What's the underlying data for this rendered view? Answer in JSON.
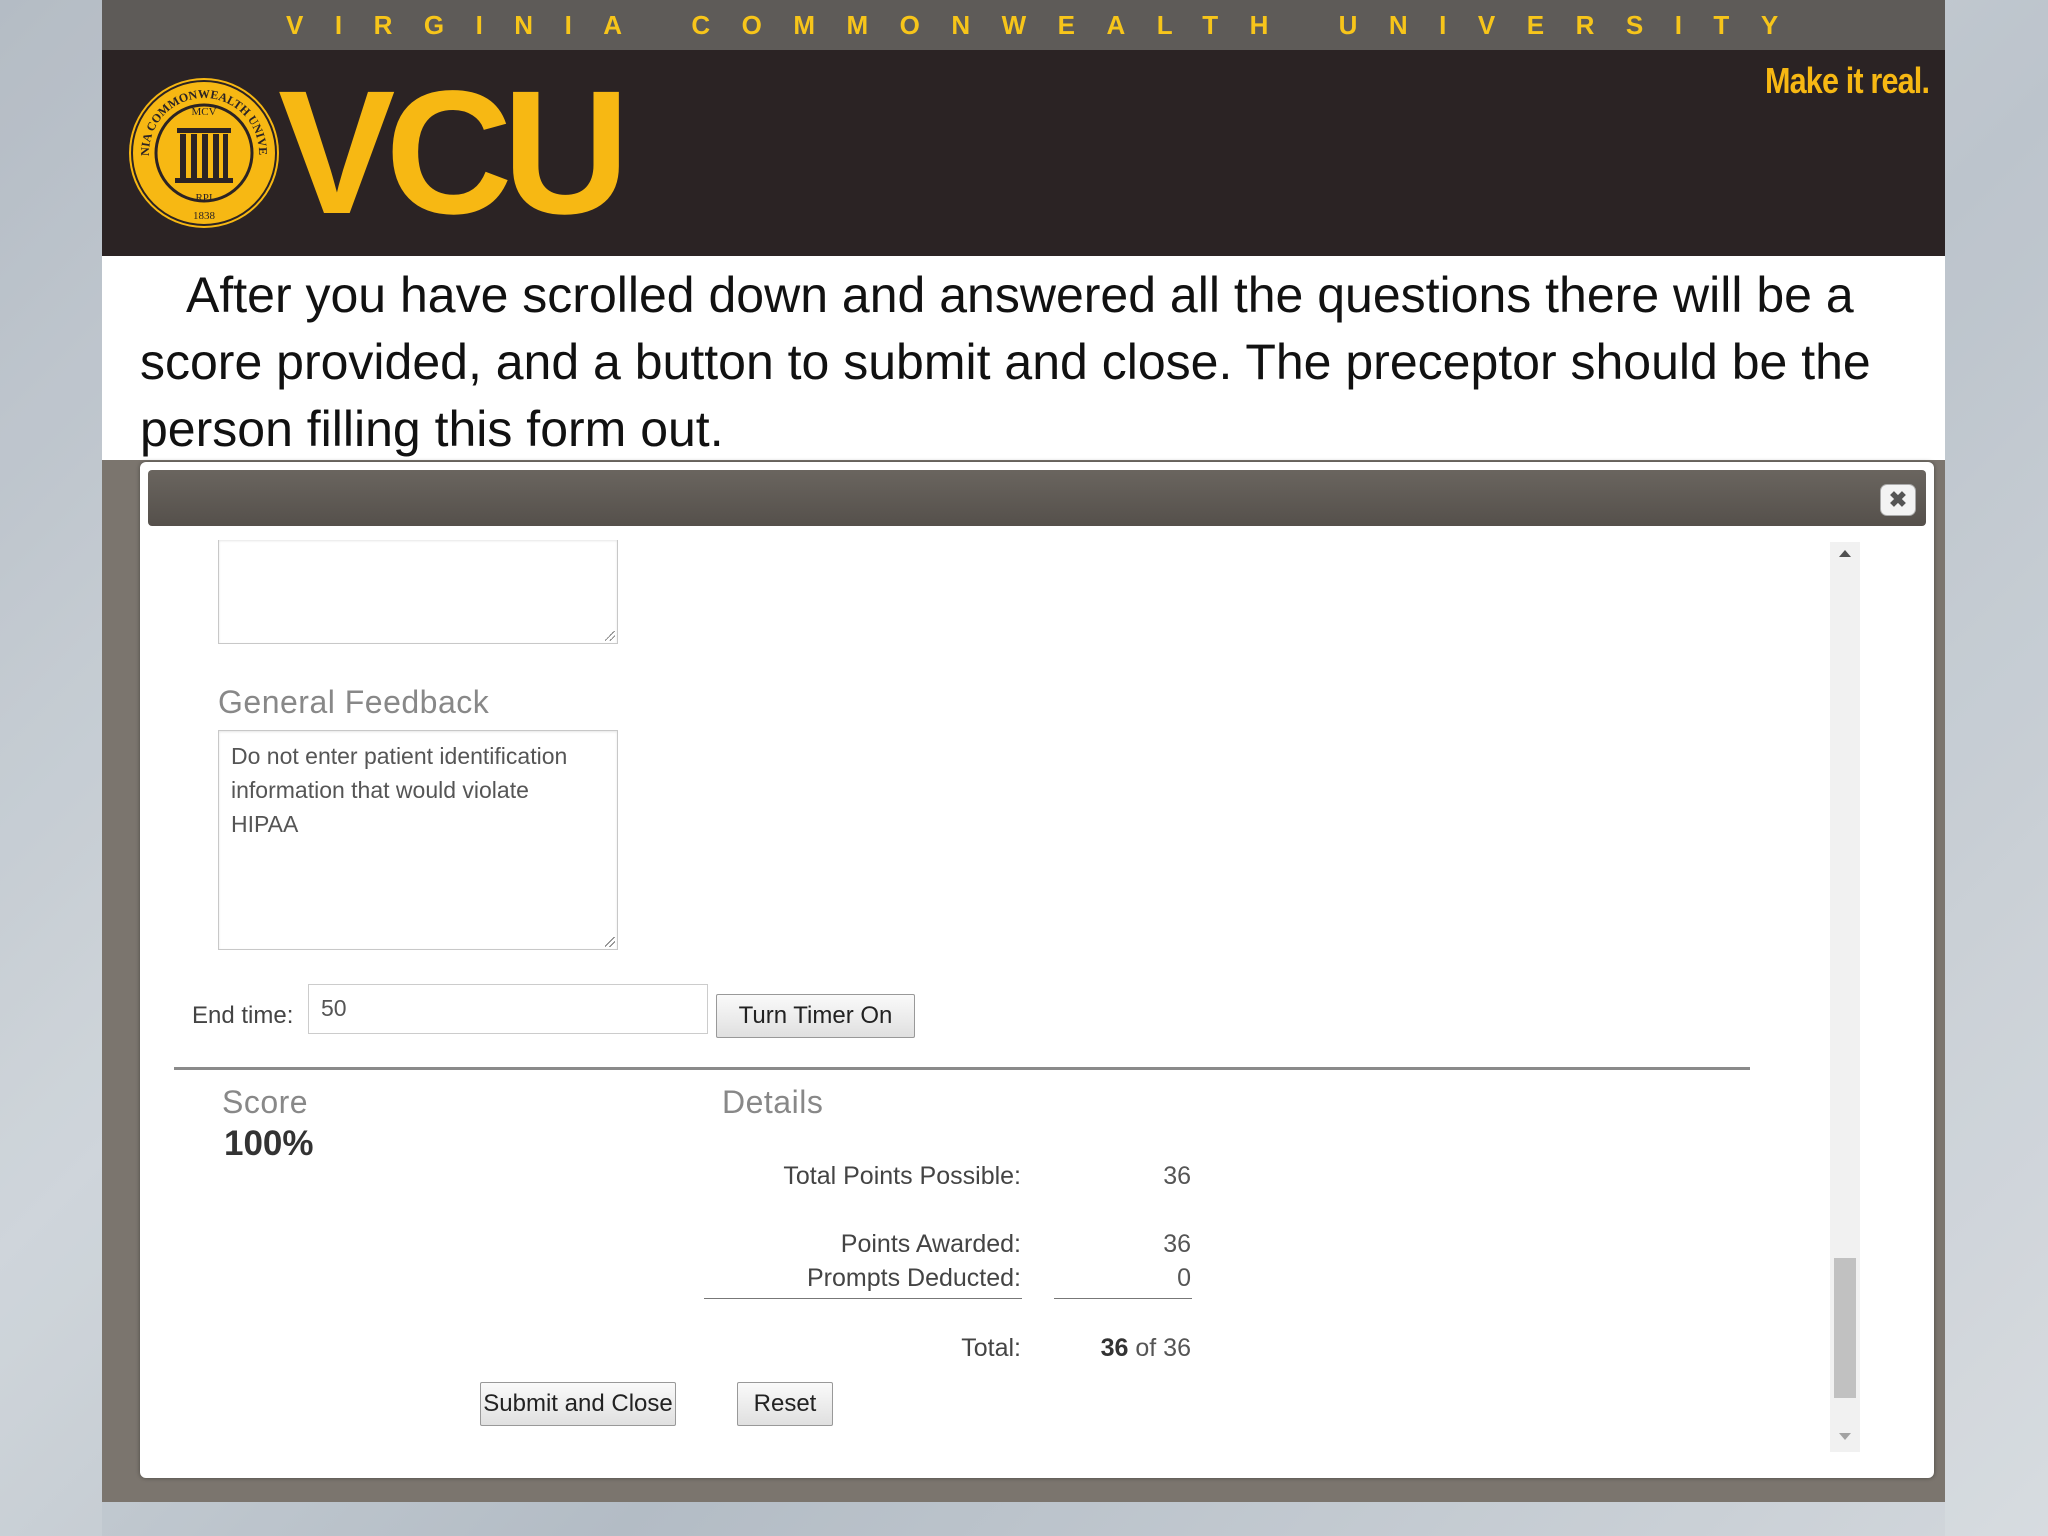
{
  "header": {
    "university": "VIRGINIA COMMONWEALTH UNIVERSITY",
    "logo": "VCU",
    "tagline": "Make it real.",
    "seal": {
      "ring_text": "VIRGINIA COMMONWEALTH UNIVERSITY",
      "top": "MCV",
      "bottom": "RPI",
      "year": "1838"
    }
  },
  "caption": "After you have scrolled down and answered all the questions there will be a score provided, and a button to submit and close. The preceptor should be the person filling this form out.",
  "dialog": {
    "close_label": "✖",
    "general_feedback": {
      "title": "General Feedback",
      "placeholder": "Do not enter patient identification information that would violate HIPAA"
    },
    "end_time": {
      "label": "End time:",
      "value": "50",
      "timer_button": "Turn Timer On"
    },
    "score": {
      "title": "Score",
      "value": "100%"
    },
    "details": {
      "title": "Details",
      "total_possible_label": "Total Points Possible:",
      "total_possible_value": "36",
      "awarded_label": "Points Awarded:",
      "awarded_value": "36",
      "prompts_label": "Prompts Deducted:",
      "prompts_value": "0",
      "total_label": "Total:",
      "total_score": "36",
      "total_of": "of 36"
    },
    "buttons": {
      "submit": "Submit and Close",
      "reset": "Reset"
    }
  }
}
